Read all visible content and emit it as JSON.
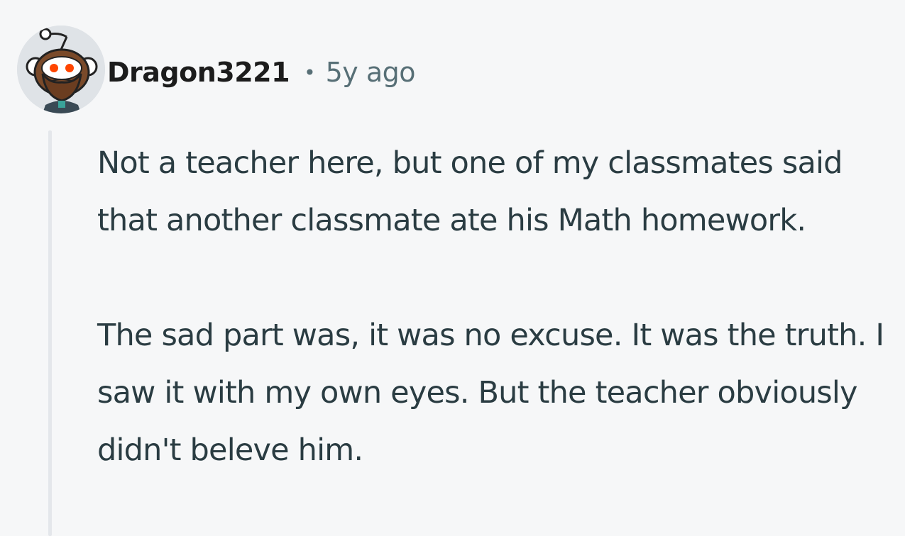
{
  "comment": {
    "author": "Dragon3221",
    "separator": "•",
    "age": "5y ago",
    "avatar_icon": "reddit-snoo-bearded-avatar-icon",
    "paragraphs": [
      "Not a teacher here, but one of my classmates said that another classmate ate his Math homework.",
      "The sad part was, it was no excuse. It was the truth. I saw it with my own eyes. But the teacher obviously didn't beleve him."
    ]
  },
  "colors": {
    "background": "#f6f7f8",
    "username": "#1c1c1c",
    "meta": "#576f76",
    "body": "#2a3c42",
    "thread_line": "#e4e7eb"
  }
}
